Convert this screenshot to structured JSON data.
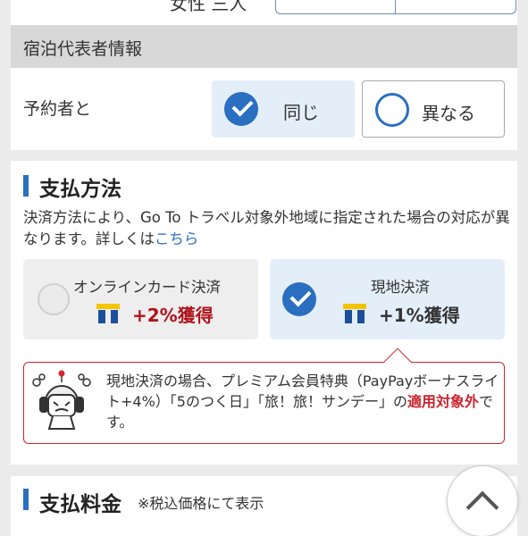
{
  "gender": {
    "label": "女性 三人"
  },
  "guest_info": {
    "section_title": "宿泊代表者情報",
    "booker_label": "予約者と",
    "option_same": "同じ",
    "option_different": "異なる",
    "selected": "同じ"
  },
  "payment": {
    "title": "支払方法",
    "description": "決済方法により、Go To トラベル対象外地域に指定された場合の対応が異なります。詳しくは",
    "link_text": "こちら",
    "options": [
      {
        "name": "オンラインカード決済",
        "points": "+2%獲得",
        "selected": false
      },
      {
        "name": "現地決済",
        "points": "+1%獲得",
        "selected": true
      }
    ],
    "notice": {
      "text_before": "現地決済の場合、プレミアム会員特典（PayPayボーナスライト+4%）「5のつく日」「旅！旅！サンデー」の",
      "highlight": "適用対象外",
      "text_after": "です。"
    }
  },
  "fee": {
    "title": "支払料金",
    "note": "※税込価格にて表示"
  },
  "colors": {
    "accent": "#2a6fc0",
    "warning": "#c9252c",
    "points": "#b0141c"
  }
}
